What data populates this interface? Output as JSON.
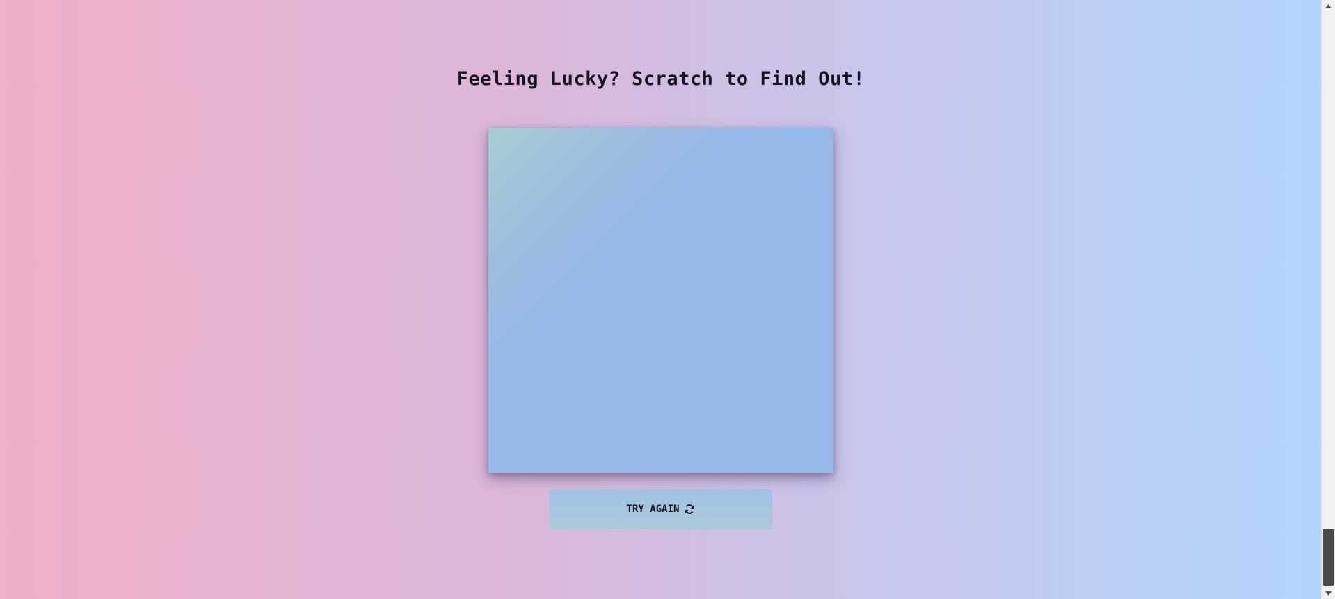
{
  "page": {
    "title": "Feeling Lucky? Scratch to Find Out!"
  },
  "scratch_card": {
    "state": "covered"
  },
  "actions": {
    "try_again_label": "TRY AGAIN",
    "try_again_icon": "refresh-icon"
  },
  "colors": {
    "background_left": "#efaec9",
    "background_right": "#b1d5fd",
    "card_surface": "#96b8e8",
    "text": "#14141e"
  }
}
